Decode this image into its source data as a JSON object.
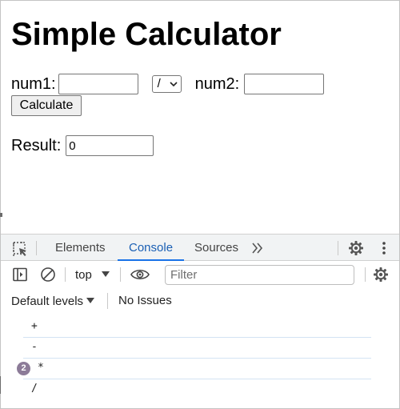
{
  "page": {
    "title": "Simple Calculator",
    "num1_label": "num1:",
    "num1_value": "",
    "operator_value": "/",
    "num2_label": "num2:",
    "num2_value": "",
    "calculate_label": "Calculate",
    "result_label": "Result:",
    "result_value": "0"
  },
  "devtools": {
    "tabs": [
      {
        "label": "Elements",
        "active": false
      },
      {
        "label": "Console",
        "active": true
      },
      {
        "label": "Sources",
        "active": false
      }
    ],
    "more_tabs_icon": "chevron-double-right-icon",
    "settings_icon": "gear-icon",
    "menu_icon": "kebab-menu-icon",
    "toolbar": {
      "context": "top",
      "filter_placeholder": "Filter",
      "filter_value": ""
    },
    "levels_label": "Default levels",
    "issues_label": "No Issues",
    "log": [
      {
        "text": "+",
        "count": ""
      },
      {
        "text": "-",
        "count": ""
      },
      {
        "text": "*",
        "count": "2"
      },
      {
        "text": "/",
        "count": ""
      }
    ],
    "colors": {
      "accent": "#1a73e8",
      "badge": "#8c7b98",
      "row_divider": "#d3e3f3"
    }
  }
}
